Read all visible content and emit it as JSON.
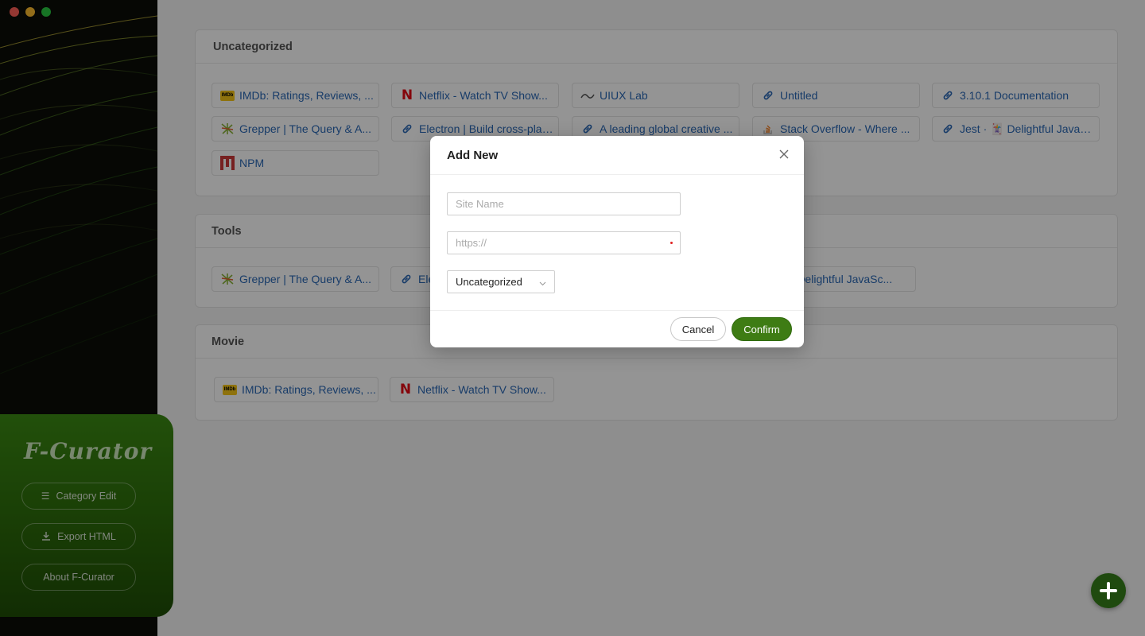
{
  "brand": {
    "name": "F-Curator"
  },
  "sidebar": {
    "buttons": [
      {
        "label": "Category Edit",
        "icon": "list-icon"
      },
      {
        "label": "Export HTML",
        "icon": "download-icon"
      },
      {
        "label": "About F-Curator",
        "icon": ""
      }
    ]
  },
  "categories": [
    {
      "title": "Uncategorized",
      "links": [
        {
          "label": "IMDb: Ratings, Reviews, ...",
          "icon": "imdb-icon"
        },
        {
          "label": "Netflix - Watch TV Show...",
          "icon": "netflix-icon"
        },
        {
          "label": "UIUX Lab",
          "icon": "uiux-lab-icon"
        },
        {
          "label": "Untitled",
          "icon": "link-icon"
        },
        {
          "label": "3.10.1 Documentation",
          "icon": "link-icon"
        },
        {
          "label": "Grepper | The Query & A...",
          "icon": "grepper-icon"
        },
        {
          "label": "Electron | Build cross-plat...",
          "icon": "link-icon"
        },
        {
          "label": "A leading global creative ...",
          "icon": "link-icon"
        },
        {
          "label": "Stack Overflow - Where ...",
          "icon": "stackoverflow-icon"
        },
        {
          "label": "Jest · 🃏 Delightful JavaSc...",
          "icon": "link-icon"
        },
        {
          "label": "NPM",
          "icon": "npm-icon"
        }
      ]
    },
    {
      "title": "Tools",
      "links": [
        {
          "label": "Grepper | The Query & A...",
          "icon": "grepper-icon"
        },
        {
          "label": "Elec",
          "icon": "link-icon"
        },
        {
          "label": "🃏 Delightful JavaSc...",
          "icon": ""
        }
      ]
    },
    {
      "title": "Movie",
      "links": [
        {
          "label": "IMDb: Ratings, Reviews, ...",
          "icon": "imdb-icon"
        },
        {
          "label": "Netflix - Watch TV Show...",
          "icon": "netflix-icon"
        }
      ]
    }
  ],
  "modal": {
    "title": "Add New",
    "site_name_placeholder": "Site Name",
    "url_placeholder": "https://",
    "category_selected": "Uncategorized",
    "cancel_label": "Cancel",
    "confirm_label": "Confirm"
  },
  "colors": {
    "accent": "#3e7c14",
    "link": "#2a68b5",
    "sidebar_panel": "#2d6d0b"
  }
}
